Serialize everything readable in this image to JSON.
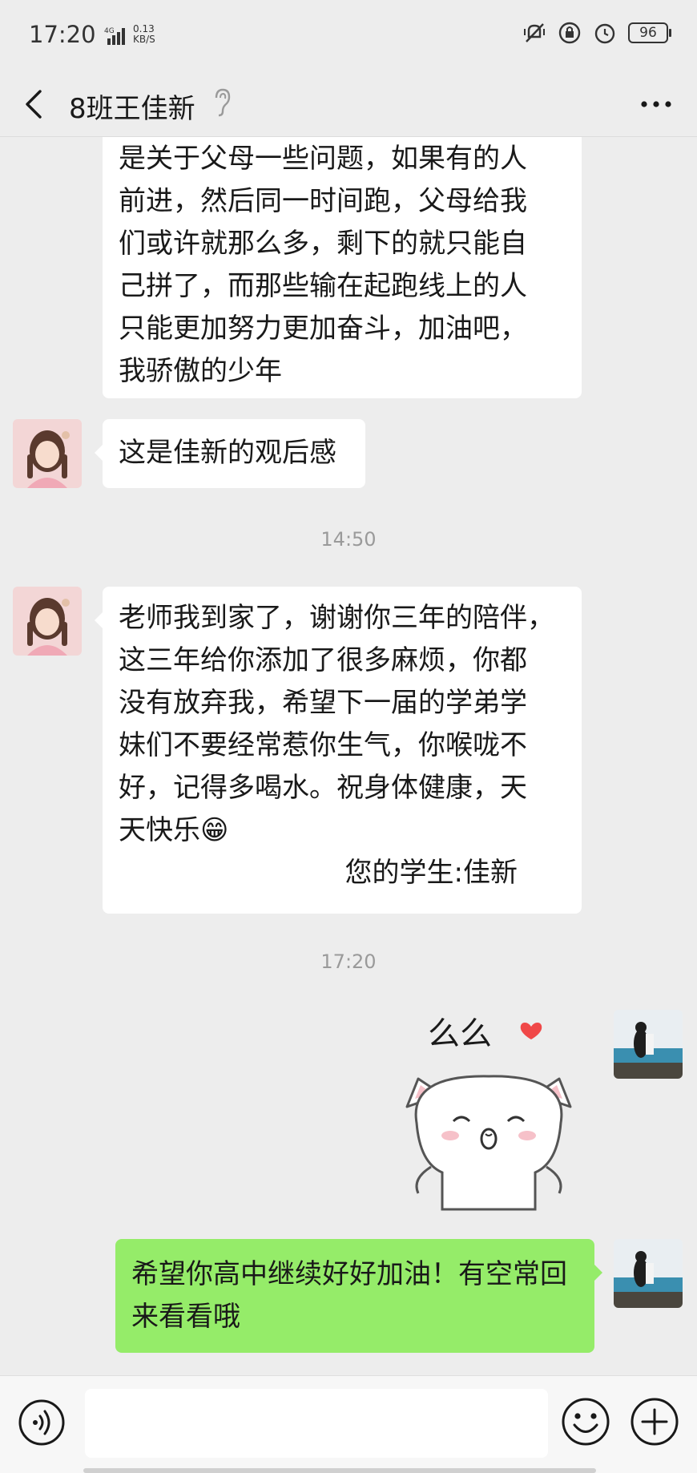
{
  "status_bar": {
    "time": "17:20",
    "network": "4G",
    "speed_value": "0.13",
    "speed_unit": "KB/S",
    "battery": "96"
  },
  "header": {
    "title": "8班王佳新",
    "back_icon": "chevron-left-icon",
    "mode_icon": "ear-icon",
    "more_icon": "more-icon"
  },
  "messages": {
    "m1_lines": [
      "是关于父母一些问题，如果有的人",
      "前进，然后同一时间跑，父母给我",
      "们或许就那么多，剩下的就只能自",
      "己拼了，而那些输在起跑线上的人",
      "只能更加努力更加奋斗，加油吧，",
      "我骄傲的少年"
    ],
    "m2": "这是佳新的观后感",
    "ts1": "14:50",
    "m3_lines": [
      "老师我到家了，谢谢你三年的陪伴，",
      "这三年给你添加了很多麻烦，你都",
      "没有放弃我，希望下一届的学弟学",
      "妹们不要经常惹你生气，你喉咙不",
      "好，记得多喝水。祝身体健康，天",
      "天快乐"
    ],
    "m3_emoji": "😁",
    "m3_signature": "您的学生:佳新",
    "ts2": "17:20",
    "sticker_text": "么么",
    "m4_lines": [
      "希望你高中继续好好加油！有空常回",
      "来看看哦"
    ]
  },
  "input_bar": {
    "voice_icon": "voice-icon",
    "emoji_icon": "emoji-icon",
    "plus_icon": "plus-icon"
  },
  "colors": {
    "background": "#ededed",
    "bubble_self": "#95ec69",
    "bubble_other": "#ffffff",
    "heart": "#f04848"
  }
}
